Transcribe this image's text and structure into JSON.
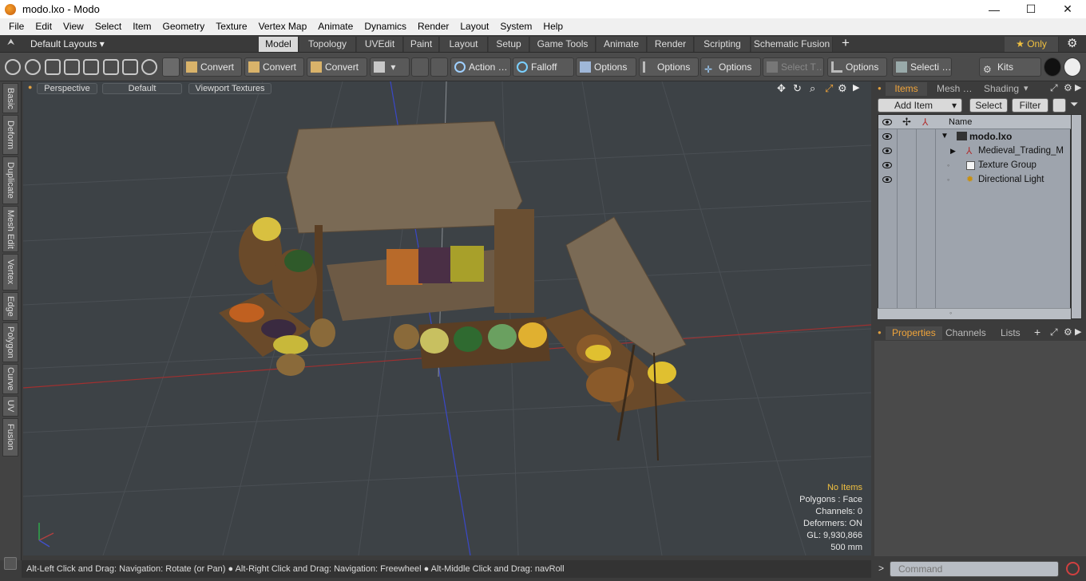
{
  "window": {
    "title": "modo.lxo - Modo",
    "minimize": "—",
    "maximize": "☐",
    "close": "✕"
  },
  "menu": [
    "File",
    "Edit",
    "View",
    "Select",
    "Item",
    "Geometry",
    "Texture",
    "Vertex Map",
    "Animate",
    "Dynamics",
    "Render",
    "Layout",
    "System",
    "Help"
  ],
  "layouts": {
    "dropdown": "Default Layouts ▾",
    "tabs": [
      "Model",
      "Topology",
      "UVEdit",
      "Paint",
      "Layout",
      "Setup",
      "Game Tools",
      "Animate",
      "Render",
      "Scripting",
      "Schematic Fusion"
    ],
    "active": "Model",
    "add": "+",
    "only": "★  Only",
    "gear": "⚙"
  },
  "toolbar": {
    "convert1": "Convert",
    "convert2": "Convert",
    "convert3": "Convert",
    "action": "Action  …",
    "falloff": "Falloff",
    "options1": "Options",
    "options2": "Options",
    "options3": "Options",
    "select_t": "Select T…",
    "options4": "Options",
    "selecti": "Selecti …",
    "kits": "Kits"
  },
  "sidebar_tabs": [
    "Basic",
    "Deform",
    "Duplicate",
    "Mesh Edit",
    "Vertex",
    "Edge",
    "Polygon",
    "Curve",
    "UV",
    "Fusion"
  ],
  "viewport": {
    "view": "Perspective",
    "shading": "Default",
    "textures": "Viewport Textures",
    "info": {
      "no_items": "No Items",
      "polygons": "Polygons : Face",
      "channels": "Channels: 0",
      "deformers": "Deformers: ON",
      "gl": "GL: 9,930,866",
      "scale": "500 mm"
    }
  },
  "status": "Alt-Left Click and Drag: Navigation: Rotate (or Pan) ● Alt-Right Click and Drag: Navigation: Freewheel ● Alt-Middle Click and Drag: navRoll",
  "items_panel": {
    "tabs": [
      "Items",
      "Mesh …",
      "Shading"
    ],
    "active": "Items",
    "add_item": "Add Item",
    "select": "Select",
    "filter": "Filter",
    "name_header": "Name",
    "rows": [
      "modo.lxo",
      "Medieval_Trading_M …",
      "Texture Group",
      "Directional Light"
    ]
  },
  "properties_panel": {
    "tabs": [
      "Properties",
      "Channels",
      "Lists"
    ],
    "active": "Properties",
    "add": "+"
  },
  "command": {
    "placeholder": "Command",
    "prompt": ">"
  },
  "colors": {
    "accent": "#f0a43a",
    "viewport_bg": "#3d4246",
    "grid_red": "#b03030",
    "grid_blue": "#3040c0"
  }
}
